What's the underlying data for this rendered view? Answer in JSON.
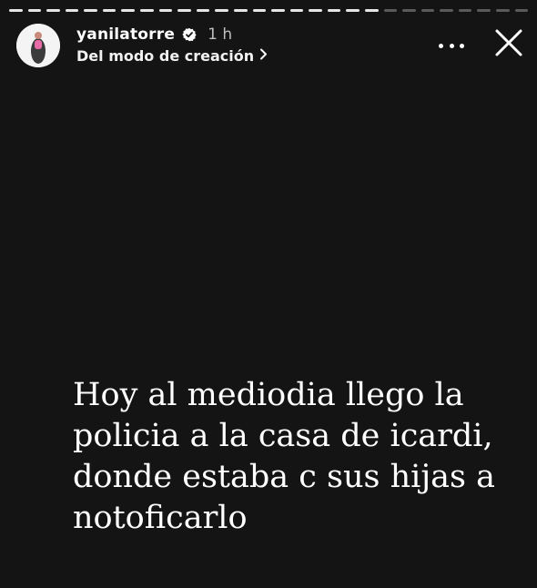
{
  "progress": {
    "total_segments": 28,
    "viewed_segments": 20
  },
  "header": {
    "username": "yanilatorre",
    "verified_icon": "verified-badge-icon",
    "time": "1 h",
    "subtitle": "Del modo de creación",
    "subtitle_icon": "chevron-right-icon",
    "more_icon": "more-options-icon",
    "close_icon": "close-icon"
  },
  "story": {
    "text": "Hoy al mediodia llego la\npolicia a la casa de icardi,\ndonde estaba c sus hijas a\nnotoficarlo"
  },
  "colors": {
    "background": "#141414",
    "text": "#ffffff",
    "unseen_progress": "#5a5a5a"
  }
}
